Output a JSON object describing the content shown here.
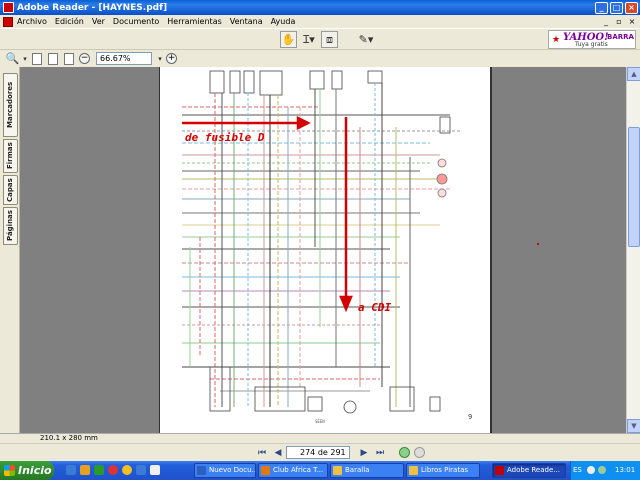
{
  "window": {
    "title": "Adobe Reader - [HAYNES.pdf]",
    "controls": {
      "minimize": "_",
      "maximize": "□",
      "close": "×"
    }
  },
  "menu": {
    "items": [
      "Archivo",
      "Edición",
      "Ver",
      "Documento",
      "Herramientas",
      "Ventana",
      "Ayuda"
    ]
  },
  "toolbar": {
    "zoom_value": "66.67%",
    "zoom_out": "−",
    "zoom_in": "+"
  },
  "yahoo": {
    "logo": "YAHOO!",
    "barra": "BARRA",
    "tagline": "Tuya gratis"
  },
  "side_tabs": [
    "Marcadores",
    "Firmas",
    "Capas",
    "Páginas"
  ],
  "document": {
    "annotation_top": "de fusible D",
    "annotation_bottom": "a CDI",
    "page_corner": "9",
    "accent_red": "#d40000"
  },
  "statusbar": {
    "page_size": "210.1 x 280 mm"
  },
  "navigation": {
    "page_indicator": "274 de 291"
  },
  "taskbar": {
    "start_label": "Inicio",
    "tasks": [
      {
        "label": "Nuevo Docu...",
        "icon_color": "#2c5fbf"
      },
      {
        "label": "Club Africa T...",
        "icon_color": "#e07a10"
      },
      {
        "label": "Baralla",
        "icon_color": "#f0c040"
      },
      {
        "label": "Libros Piratas",
        "icon_color": "#f0c040"
      },
      {
        "label": "Adobe Reade...",
        "icon_color": "#c00000"
      }
    ],
    "language": "ES",
    "clock": "13:01"
  }
}
